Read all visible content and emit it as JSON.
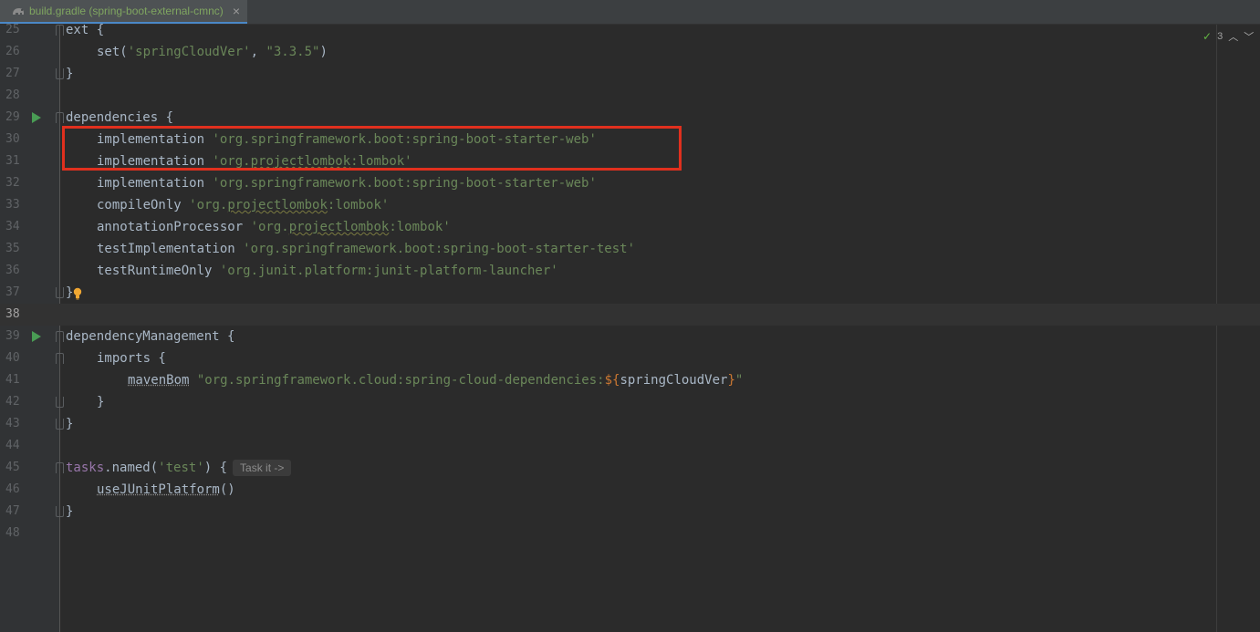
{
  "tab": {
    "title": "build.gradle (spring-boot-external-cmnc)",
    "close_label": "×",
    "icon": "gradle-elephant-icon"
  },
  "inspection": {
    "count": "3",
    "up_label": "^",
    "down_label": "v"
  },
  "hint": {
    "label": "Task it ->"
  },
  "lines": {
    "l25": "25",
    "l26": "26",
    "l27": "27",
    "l28": "28",
    "l29": "29",
    "l30": "30",
    "l31": "31",
    "l32": "32",
    "l33": "33",
    "l34": "34",
    "l35": "35",
    "l36": "36",
    "l37": "37",
    "l38": "38",
    "l39": "39",
    "l40": "40",
    "l41": "41",
    "l42": "42",
    "l43": "43",
    "l44": "44",
    "l45": "45",
    "l46": "46",
    "l47": "47",
    "l48": "48"
  },
  "code": {
    "ext_open": "ext {",
    "set_call": "set(",
    "set_key": "'springCloudVer'",
    "set_sep": ", ",
    "set_val": "\"3.3.5\"",
    "set_close": ")",
    "brace_close": "}",
    "deps_open": "dependencies {",
    "implementation": "implementation ",
    "starter_web": "'org.springframework.boot:spring-boot-starter-web'",
    "lombok_prefix": "'org.",
    "lombok_mid": "projectlombok",
    "lombok_suffix": ":lombok'",
    "compile_only": "compileOnly ",
    "annotation_processor": "annotationProcessor ",
    "test_implementation": "testImplementation ",
    "starter_test": "'org.springframework.boot:spring-boot-starter-test'",
    "test_runtime_only": "testRuntimeOnly ",
    "junit_launcher": "'org.junit.platform:junit-platform-launcher'",
    "dep_mgmt_open": "dependencyManagement {",
    "imports_open": "imports {",
    "maven_bom": "mavenBom",
    "bom_str_prefix": " \"org.springframework.cloud:spring-cloud-dependencies:",
    "bom_interp_open": "${",
    "bom_interp_var": "springCloudVer",
    "bom_interp_close": "}",
    "bom_str_suffix": "\"",
    "tasks": "tasks",
    "named_call": ".named(",
    "named_arg": "'test'",
    "named_close": ") {",
    "use_junit": "useJUnitPlatform",
    "use_junit_parens": "()"
  }
}
